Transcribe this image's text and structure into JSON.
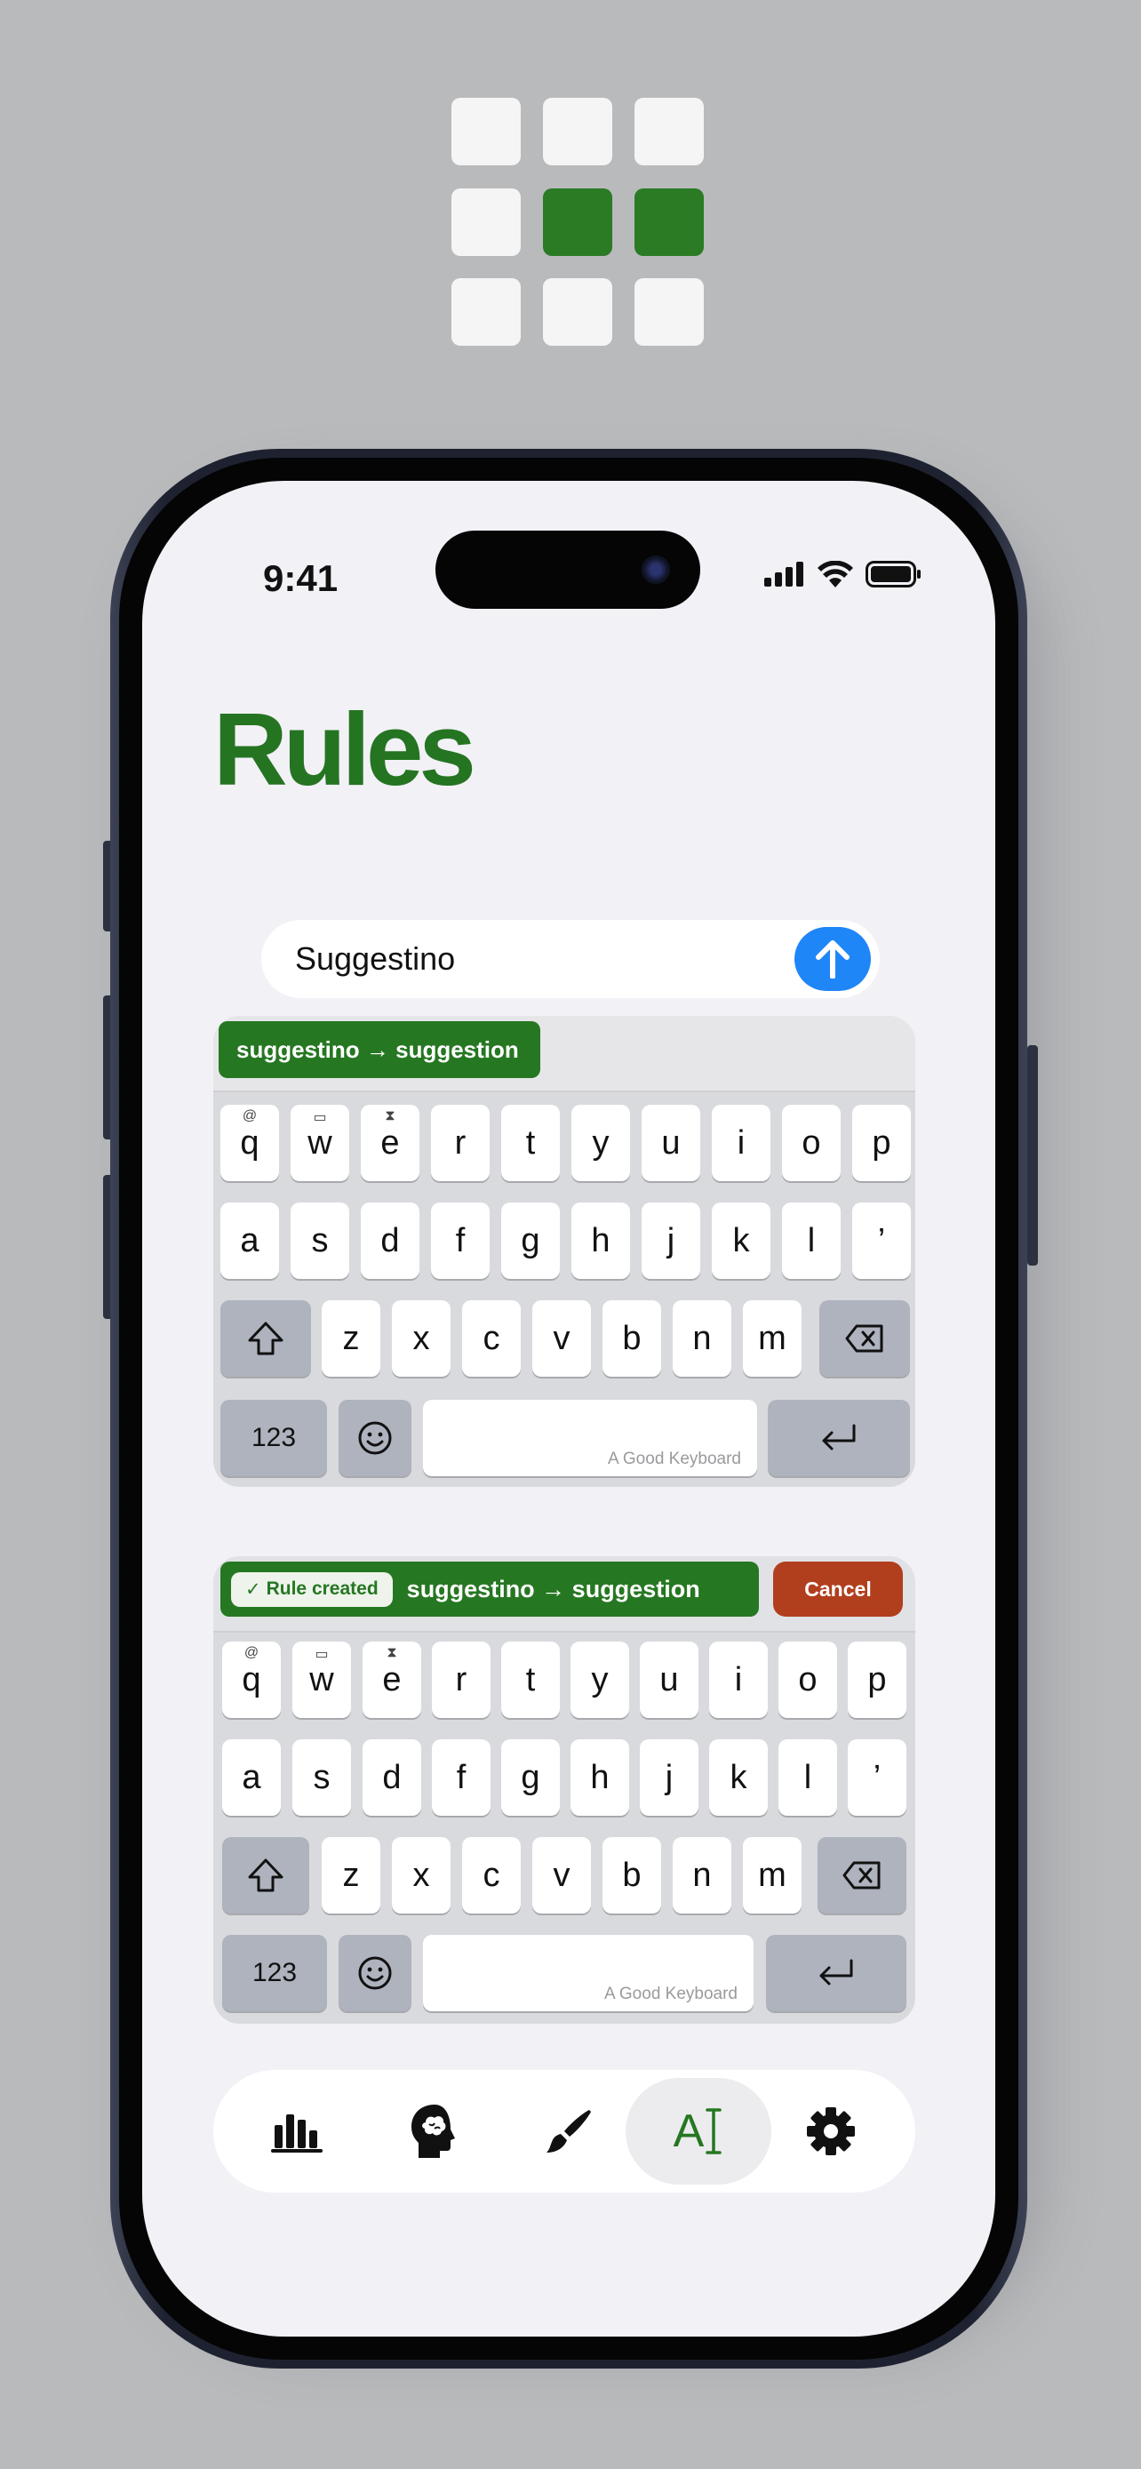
{
  "app": {
    "title": "Rules",
    "brand_green": "#267722",
    "accent_blue": "#1f86f8",
    "cancel_red": "#b13f1e"
  },
  "logo": {
    "grid": [
      [
        false,
        false,
        false
      ],
      [
        false,
        true,
        true
      ],
      [
        false,
        false,
        false
      ]
    ],
    "on_color": "#2a7b24",
    "off_color": "#f5f5f5"
  },
  "status_bar": {
    "time": "9:41",
    "icons": [
      "cellular-signal-icon",
      "wifi-icon",
      "battery-icon"
    ]
  },
  "input": {
    "value": "Suggestino",
    "send_icon": "arrow-up-icon"
  },
  "keyboard_1": {
    "suggestion": "suggestino → suggestion",
    "watermark": "A Good Keyboard"
  },
  "keyboard_2": {
    "badge": "Rule created",
    "badge_check": "✓",
    "suggestion": "suggestino → suggestion",
    "cancel_label": "Cancel",
    "watermark": "A Good Keyboard"
  },
  "keys": {
    "row1": [
      "q",
      "w",
      "e",
      "r",
      "t",
      "y",
      "u",
      "i",
      "o",
      "p"
    ],
    "row1_hints": [
      "@",
      "briefcase",
      "hourglass"
    ],
    "row2": [
      "a",
      "s",
      "d",
      "f",
      "g",
      "h",
      "j",
      "k",
      "l",
      "’"
    ],
    "row3": [
      "z",
      "x",
      "c",
      "v",
      "b",
      "n",
      "m"
    ],
    "numbers_label": "123"
  },
  "tabbar": {
    "tabs": [
      {
        "icon": "stats-chart-icon"
      },
      {
        "icon": "brain-head-icon"
      },
      {
        "icon": "paintbrush-icon"
      },
      {
        "icon": "text-cursor-icon",
        "active": true,
        "label": "A"
      },
      {
        "icon": "gear-icon"
      }
    ]
  }
}
